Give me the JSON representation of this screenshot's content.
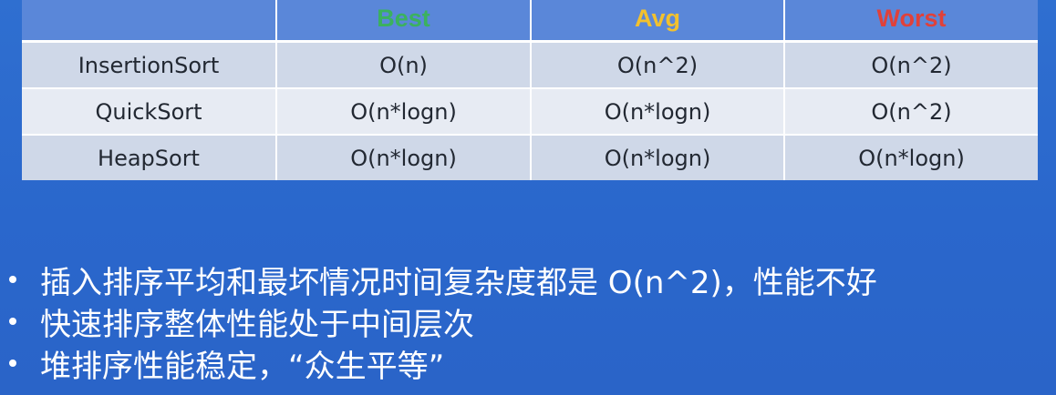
{
  "table": {
    "headers": [
      {
        "label": "",
        "color": ""
      },
      {
        "label": "Best",
        "color": "#3bb15e"
      },
      {
        "label": "Avg",
        "color": "#f2c12e"
      },
      {
        "label": "Worst",
        "color": "#e0413a"
      }
    ],
    "rows": [
      [
        "InsertionSort",
        "O(n)",
        "O(n^2)",
        "O(n^2)"
      ],
      [
        "QuickSort",
        "O(n*logn)",
        "O(n*logn)",
        "O(n^2)"
      ],
      [
        "HeapSort",
        "O(n*logn)",
        "O(n*logn)",
        "O(n*logn)"
      ]
    ]
  },
  "bullets": [
    "插入排序平均和最坏情况时间复杂度都是 O(n^2)，性能不好",
    "快速排序整体性能处于中间层次",
    "堆排序性能稳定，“众生平等”"
  ],
  "colors": {
    "background": "#2b68cc",
    "header_bg": "#5a87d9",
    "row_odd": "#cfd8e8",
    "row_even": "#e7ebf3"
  }
}
